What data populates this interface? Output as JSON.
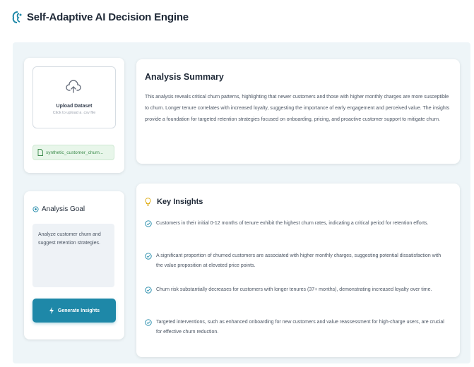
{
  "app": {
    "title": "Self-Adaptive AI Decision Engine",
    "accent_color": "#1e88a8",
    "logo_icon": "brain-logo"
  },
  "upload": {
    "icon": "cloud-upload-icon",
    "title": "Upload Dataset",
    "subtitle": "Click to upload a .csv file",
    "file_name": "synthetic_customer_churn..."
  },
  "goal": {
    "icon": "target-icon",
    "title": "Analysis Goal",
    "text": "Analyze customer churn and suggest retention strategies.",
    "button_label": "Generate Insights",
    "button_icon": "bolt-icon"
  },
  "summary": {
    "title": "Analysis Summary",
    "body": "This analysis reveals critical churn patterns, highlighting that newer customers and those with higher monthly charges are more susceptible to churn. Longer tenure correlates with increased loyalty, suggesting the importance of early engagement and perceived value. The insights provide a foundation for targeted retention strategies focused on onboarding, pricing, and proactive customer support to mitigate churn."
  },
  "insights": {
    "icon": "lightbulb-icon",
    "title": "Key Insights",
    "items": [
      "Customers in their initial 0-12 months of tenure exhibit the highest churn rates, indicating a critical period for retention efforts.",
      "A significant proportion of churned customers are associated with higher monthly charges, suggesting potential dissatisfaction with the value proposition at elevated price points.",
      "Churn risk substantially decreases for customers with longer tenures (37+ months), demonstrating increased loyalty over time.",
      "Targeted interventions, such as enhanced onboarding for new customers and value reassessment for high-charge users, are crucial for effective churn reduction."
    ]
  }
}
